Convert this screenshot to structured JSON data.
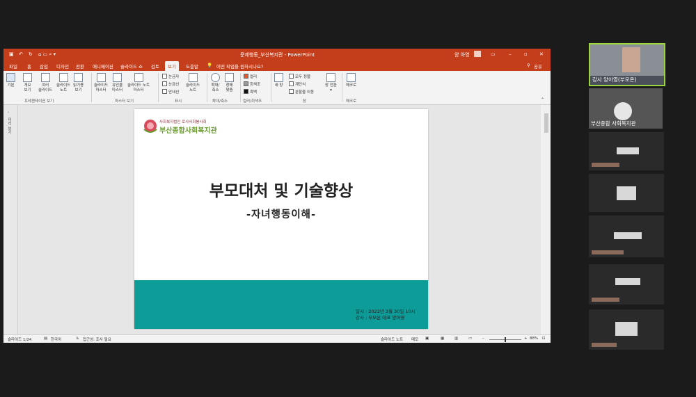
{
  "ppt": {
    "window_title": "문제행동_부산복지관  -  PowerPoint",
    "user_name": "양 아영",
    "share_label": "공유",
    "tabs": [
      "파일",
      "홈",
      "삽입",
      "디자인",
      "전환",
      "애니메이션",
      "슬라이드 쇼",
      "검토",
      "보기",
      "도움말"
    ],
    "active_tab": "보기",
    "tell_me": "어떤 작업을 원하시나요?",
    "ribbon": {
      "buttons": [
        "기본",
        "개요\n보기",
        "여러\n슬라이드",
        "슬라이드\n노트",
        "읽기용\n보기",
        "슬라이드\n마스터",
        "유인물\n마스터",
        "슬라이드 노트\n마스터",
        "슬라이드\n노트",
        "확대/\n축소",
        "창에\n맞춤",
        "새 창",
        "창 전환\n▾",
        "매크로"
      ],
      "checks": [
        "눈금자",
        "눈금선",
        "안내선"
      ],
      "color_options": [
        "컬러",
        "회색조",
        "흑백"
      ],
      "window_items": [
        "모두 정렬",
        "계단식",
        "분할줄 이동"
      ],
      "groups": [
        "프레젠테이션 보기",
        "마스터 보기",
        "표시",
        "확대/축소",
        "컬러/회색조",
        "창",
        "매크로"
      ]
    },
    "thumb_label": "미리 보기",
    "status": {
      "slide": "슬라이드 1/24",
      "language": "한국어",
      "accessibility": "접근성: 조사 필요",
      "notes": "슬라이드 노트",
      "memo": "메모",
      "zoom": "88%"
    }
  },
  "slide": {
    "org_small": "사회복지법인 로사사회봉사회",
    "org_big": "부산종합사회복지관",
    "title": "부모대처 및 기술향상",
    "subtitle": "-자녀행동이해-",
    "date_line": "일시 : 2022년 3월 30일 10시",
    "lecturer_line": "강사 : 부모온 대표 양아영"
  },
  "participants": [
    {
      "name": "강사 양아영(부모온)"
    },
    {
      "name": "부산종합 사회복지관"
    }
  ],
  "colors": {
    "ppt_accent": "#c43e1c",
    "slide_teal": "#0d9c98",
    "logo_green": "#6b9c2e"
  }
}
